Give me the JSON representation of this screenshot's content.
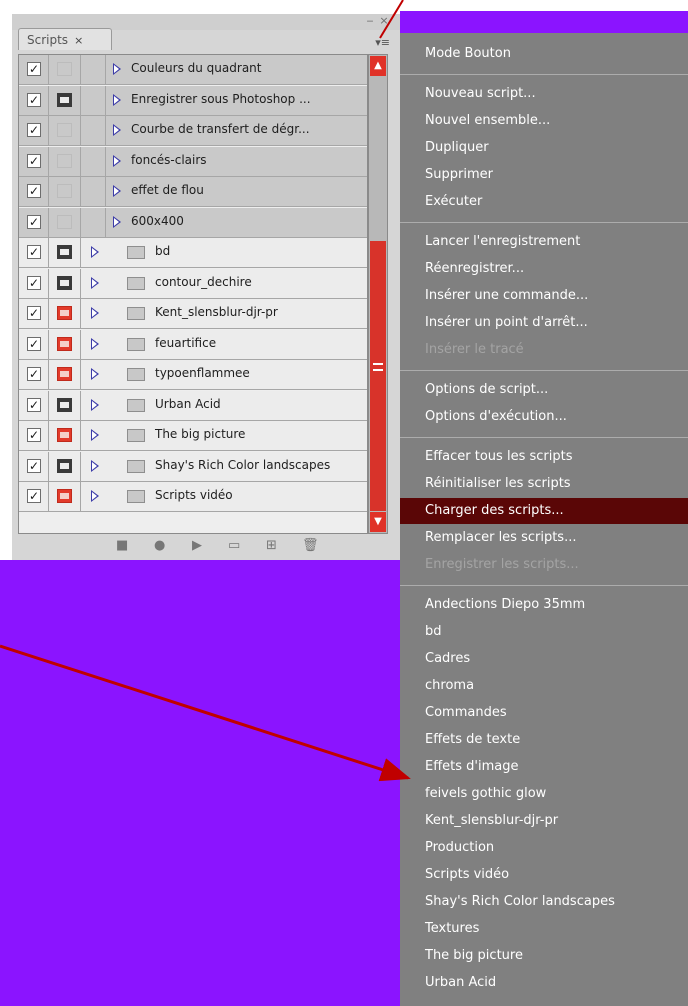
{
  "panel": {
    "tab_label": "Scripts",
    "tab_close": "×",
    "minimize": "‒",
    "close": "×",
    "menu_glyph": "▾≡",
    "actions": [
      {
        "label": "Couleurs du quadrant",
        "checked": true,
        "dialog": "none"
      },
      {
        "label": "Enregistrer sous Photoshop ...",
        "checked": true,
        "dialog": "on"
      },
      {
        "label": "Courbe de transfert de dégr...",
        "checked": true,
        "dialog": "none"
      },
      {
        "label": "foncés-clairs",
        "checked": true,
        "dialog": "none"
      },
      {
        "label": "effet de flou",
        "checked": true,
        "dialog": "none"
      },
      {
        "label": "600x400",
        "checked": true,
        "dialog": "none"
      }
    ],
    "sets": [
      {
        "label": "bd",
        "checked": true,
        "dialog": "on"
      },
      {
        "label": "contour_dechire",
        "checked": true,
        "dialog": "on"
      },
      {
        "label": "Kent_slensblur-djr-pr",
        "checked": true,
        "dialog": "red"
      },
      {
        "label": "feuartifice",
        "checked": true,
        "dialog": "red"
      },
      {
        "label": "typoenflammee",
        "checked": true,
        "dialog": "red"
      },
      {
        "label": "Urban Acid",
        "checked": true,
        "dialog": "on"
      },
      {
        "label": "The big picture",
        "checked": true,
        "dialog": "red"
      },
      {
        "label": "Shay's Rich Color landscapes",
        "checked": true,
        "dialog": "on"
      },
      {
        "label": "Scripts vidéo",
        "checked": true,
        "dialog": "red"
      }
    ],
    "toolbar": {
      "stop": "■",
      "record": "●",
      "play": "▶",
      "new_set": "▭",
      "new_action": "⊞",
      "delete": "🗑"
    }
  },
  "menu": {
    "groups": [
      [
        {
          "label": "Mode Bouton",
          "disabled": false
        }
      ],
      [
        {
          "label": "Nouveau script...",
          "disabled": false
        },
        {
          "label": "Nouvel ensemble...",
          "disabled": false
        },
        {
          "label": "Dupliquer",
          "disabled": false
        },
        {
          "label": "Supprimer",
          "disabled": false
        },
        {
          "label": "Exécuter",
          "disabled": false
        }
      ],
      [
        {
          "label": "Lancer l'enregistrement",
          "disabled": false
        },
        {
          "label": "Réenregistrer...",
          "disabled": false
        },
        {
          "label": "Insérer une commande...",
          "disabled": false
        },
        {
          "label": "Insérer un point d'arrêt...",
          "disabled": false
        },
        {
          "label": "Insérer le tracé",
          "disabled": true
        }
      ],
      [
        {
          "label": "Options de script...",
          "disabled": false
        },
        {
          "label": "Options d'exécution...",
          "disabled": false
        }
      ],
      [
        {
          "label": "Effacer tous les scripts",
          "disabled": false
        },
        {
          "label": "Réinitialiser les scripts",
          "disabled": false
        },
        {
          "label": "Charger des scripts...",
          "disabled": false,
          "highlighted": true
        },
        {
          "label": "Remplacer les scripts...",
          "disabled": false
        },
        {
          "label": "Enregistrer les scripts...",
          "disabled": true
        }
      ],
      [
        {
          "label": "Andections Diepo 35mm",
          "disabled": false
        },
        {
          "label": "bd",
          "disabled": false
        },
        {
          "label": "Cadres",
          "disabled": false
        },
        {
          "label": "chroma",
          "disabled": false
        },
        {
          "label": "Commandes",
          "disabled": false
        },
        {
          "label": "Effets de texte",
          "disabled": false
        },
        {
          "label": "Effets d'image",
          "disabled": false
        },
        {
          "label": "feivels gothic glow",
          "disabled": false
        },
        {
          "label": "Kent_slensblur-djr-pr",
          "disabled": false
        },
        {
          "label": "Production",
          "disabled": false
        },
        {
          "label": "Scripts vidéo",
          "disabled": false
        },
        {
          "label": "Shay's Rich Color landscapes",
          "disabled": false
        },
        {
          "label": "Textures",
          "disabled": false
        },
        {
          "label": "The big picture",
          "disabled": false
        },
        {
          "label": "Urban Acid",
          "disabled": false
        }
      ]
    ]
  },
  "colors": {
    "background": "#8b14ff",
    "menu_bg": "#808080",
    "menu_highlight": "#5a0606",
    "arrow": "#c00000",
    "scrollbar": "#e03228"
  }
}
